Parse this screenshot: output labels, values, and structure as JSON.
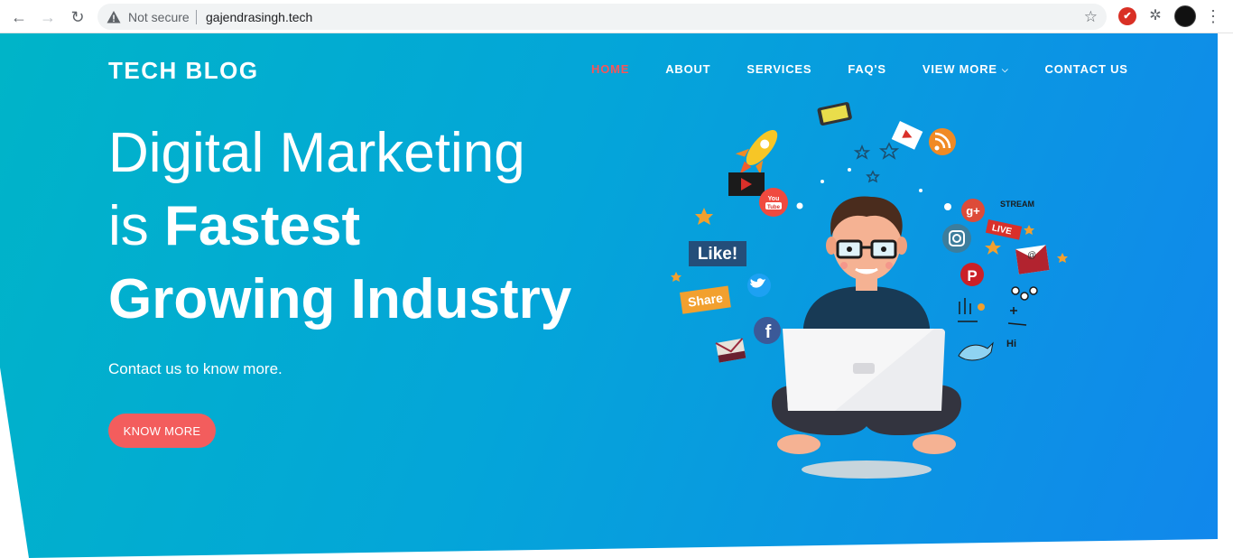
{
  "browser": {
    "not_secure": "Not secure",
    "url": "gajendrasingh.tech"
  },
  "nav": {
    "logo": "TECH BLOG",
    "items": [
      {
        "label": "HOME",
        "active": true
      },
      {
        "label": "ABOUT"
      },
      {
        "label": "SERVICES"
      },
      {
        "label": "FAQ'S"
      },
      {
        "label": "VIEW MORE"
      },
      {
        "label": "CONTACT US"
      }
    ]
  },
  "hero": {
    "line1": "Digital Marketing",
    "line2_prefix": "is ",
    "line2_bold": "Fastest",
    "line3": "Growing Industry",
    "subtext": "Contact us to know more.",
    "button": "KNOW MORE"
  },
  "illustration": {
    "like": "Like!",
    "share": "Share",
    "live": "LIVE",
    "stream": "STREAM",
    "youtube": "You Tube",
    "hi": "Hi"
  },
  "colors": {
    "accent": "#f6555a",
    "button": "#f35d5d",
    "gradient_start": "#00b4c8",
    "gradient_end": "#1187ec"
  }
}
